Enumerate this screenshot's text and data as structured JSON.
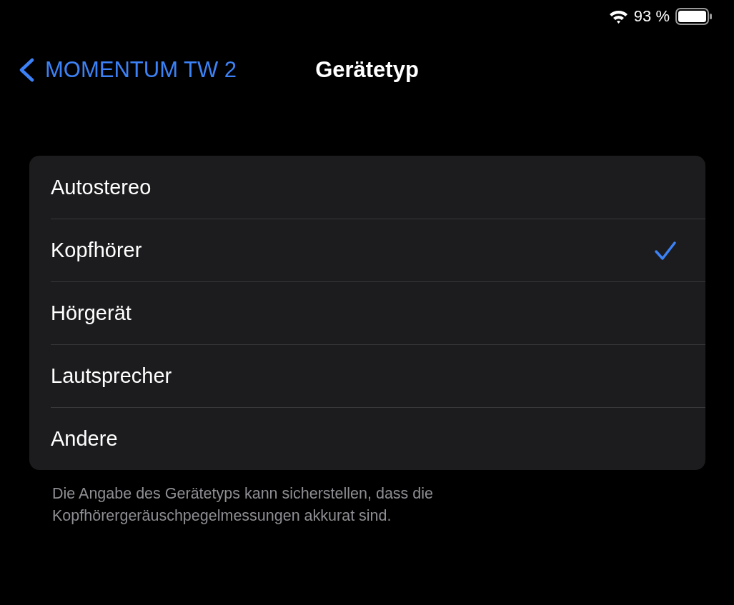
{
  "status_bar": {
    "battery": "93 %"
  },
  "nav": {
    "back_label": "MOMENTUM TW 2",
    "title": "Gerätetyp"
  },
  "options": [
    {
      "label": "Autostereo",
      "selected": false
    },
    {
      "label": "Kopfhörer",
      "selected": true
    },
    {
      "label": "Hörgerät",
      "selected": false
    },
    {
      "label": "Lautsprecher",
      "selected": false
    },
    {
      "label": "Andere",
      "selected": false
    }
  ],
  "footer": "Die Angabe des Gerätetyps kann sicherstellen, dass die Kopfhörergeräuschpegelmessungen akkurat sind."
}
